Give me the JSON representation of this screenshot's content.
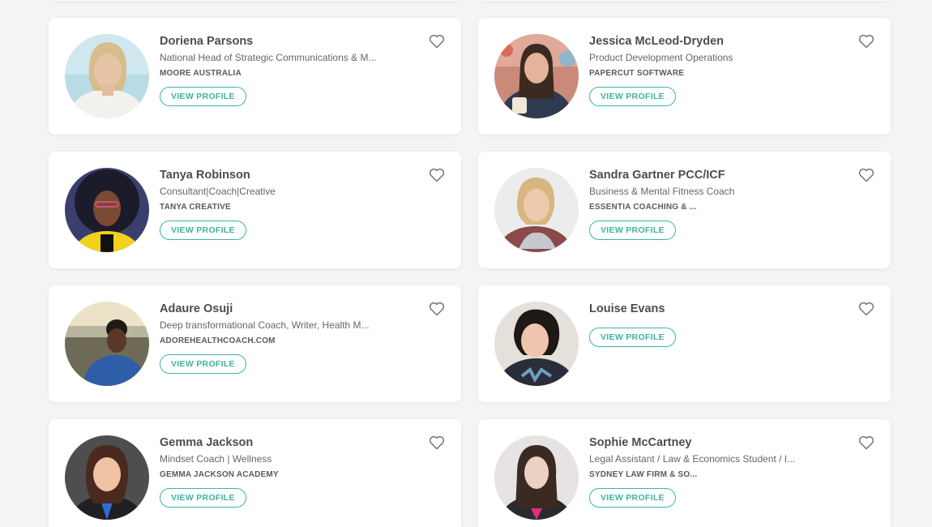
{
  "profiles": [
    {
      "name": "Doriena Parsons",
      "title": "National Head of Strategic Communications & M...",
      "company": "MOORE AUSTRALIA",
      "button": "VIEW PROFILE",
      "favorite_icon": "heart-outline-icon"
    },
    {
      "name": "Jessica McLeod-Dryden",
      "title": "Product Development Operations",
      "company": "PAPERCUT SOFTWARE",
      "button": "VIEW PROFILE",
      "favorite_icon": "heart-outline-icon"
    },
    {
      "name": "Tanya Robinson",
      "title": "Consultant|Coach|Creative",
      "company": "TANYA CREATIVE",
      "button": "VIEW PROFILE",
      "favorite_icon": "heart-outline-icon"
    },
    {
      "name": "Sandra Gartner PCC/ICF",
      "title": "Business & Mental Fitness Coach",
      "company": "ESSENTIA COACHING & ...",
      "button": "VIEW PROFILE",
      "favorite_icon": "heart-outline-icon"
    },
    {
      "name": "Adaure Osuji",
      "title": "Deep transformational Coach, Writer, Health M...",
      "company": "ADOREHEALTHCOACH.COM",
      "button": "VIEW PROFILE",
      "favorite_icon": "heart-outline-icon"
    },
    {
      "name": "Louise Evans",
      "button": "VIEW PROFILE",
      "favorite_icon": "heart-outline-icon"
    },
    {
      "name": "Gemma Jackson",
      "title": "Mindset Coach | Wellness",
      "company": "GEMMA JACKSON ACADEMY",
      "button": "VIEW PROFILE",
      "favorite_icon": "heart-outline-icon"
    },
    {
      "name": "Sophie McCartney",
      "title": "Legal Assistant / Law & Economics Student / I...",
      "company": "SYDNEY LAW FIRM & SO...",
      "button": "VIEW PROFILE",
      "favorite_icon": "heart-outline-icon"
    }
  ],
  "colors": {
    "accent": "#3bb5a3",
    "background": "#f4f4f4",
    "card": "#ffffff",
    "heart": "#777777"
  }
}
